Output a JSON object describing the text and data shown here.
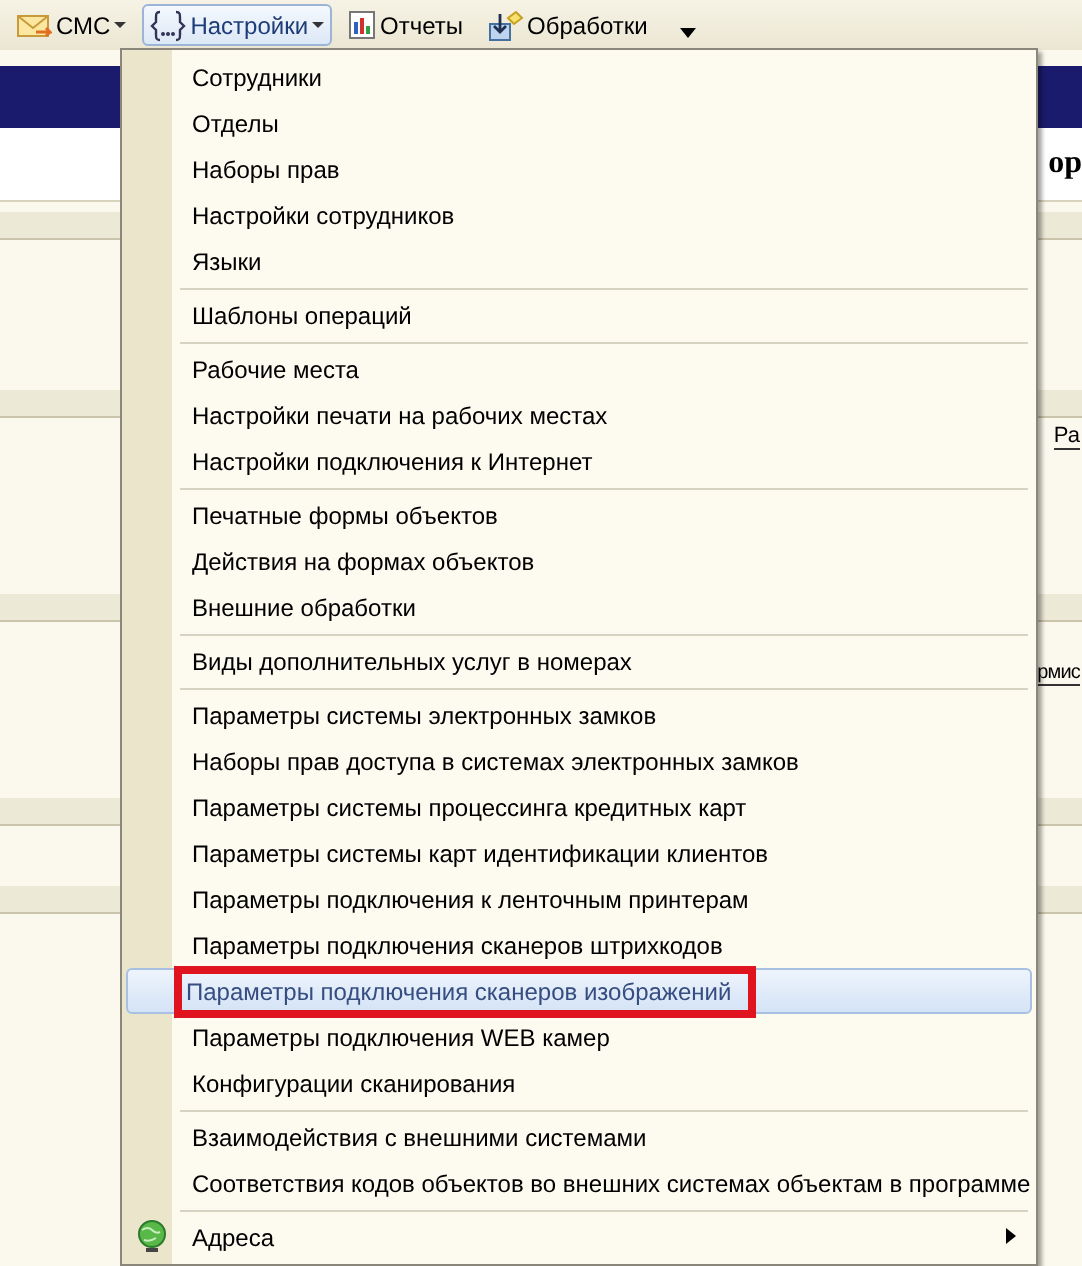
{
  "toolbar": [
    {
      "label": "СМС",
      "kind": "sms",
      "dropdown": true,
      "selected": false
    },
    {
      "label": "Настройки",
      "kind": "settings",
      "dropdown": true,
      "selected": true
    },
    {
      "label": "Отчеты",
      "kind": "reports",
      "dropdown": false,
      "selected": false
    },
    {
      "label": "Обработки",
      "kind": "tools",
      "dropdown": false,
      "selected": false
    }
  ],
  "background": {
    "header_fragment": "ор",
    "column_fragment": "Ра",
    "panel_fragment": "рмис"
  },
  "menu": {
    "groups": [
      [
        {
          "label": "Сотрудники",
          "kind": "command",
          "selected": false,
          "marked": false
        },
        {
          "label": "Отделы",
          "kind": "command",
          "selected": false,
          "marked": false
        },
        {
          "label": "Наборы прав",
          "kind": "command",
          "selected": false,
          "marked": false
        },
        {
          "label": "Настройки сотрудников",
          "kind": "command",
          "selected": false,
          "marked": false
        },
        {
          "label": "Языки",
          "kind": "command",
          "selected": false,
          "marked": false
        }
      ],
      [
        {
          "label": "Шаблоны операций",
          "kind": "command",
          "selected": false,
          "marked": false
        }
      ],
      [
        {
          "label": "Рабочие места",
          "kind": "command",
          "selected": false,
          "marked": false
        },
        {
          "label": "Настройки печати на рабочих местах",
          "kind": "command",
          "selected": false,
          "marked": false
        },
        {
          "label": "Настройки подключения к Интернет",
          "kind": "command",
          "selected": false,
          "marked": false
        }
      ],
      [
        {
          "label": "Печатные формы объектов",
          "kind": "command",
          "selected": false,
          "marked": false
        },
        {
          "label": "Действия на формах объектов",
          "kind": "command",
          "selected": false,
          "marked": false
        },
        {
          "label": "Внешние обработки",
          "kind": "command",
          "selected": false,
          "marked": false
        }
      ],
      [
        {
          "label": "Виды дополнительных услуг в номерах",
          "kind": "command",
          "selected": false,
          "marked": false
        }
      ],
      [
        {
          "label": "Параметры системы электронных замков",
          "kind": "command",
          "selected": false,
          "marked": false
        },
        {
          "label": "Наборы прав доступа в системах электронных замков",
          "kind": "command",
          "selected": false,
          "marked": false
        },
        {
          "label": "Параметры системы процессинга кредитных карт",
          "kind": "command",
          "selected": false,
          "marked": false
        },
        {
          "label": "Параметры системы карт идентификации клиентов",
          "kind": "command",
          "selected": false,
          "marked": false
        },
        {
          "label": "Параметры подключения к ленточным принтерам",
          "kind": "command",
          "selected": false,
          "marked": false
        },
        {
          "label": "Параметры подключения сканеров штрихкодов",
          "kind": "command",
          "selected": false,
          "marked": false
        },
        {
          "label": "Параметры подключения сканеров изображений",
          "kind": "command",
          "selected": true,
          "marked": true
        },
        {
          "label": "Параметры подключения WEB камер",
          "kind": "command",
          "selected": false,
          "marked": false
        },
        {
          "label": "Конфигурации сканирования",
          "kind": "command",
          "selected": false,
          "marked": false
        }
      ],
      [
        {
          "label": "Взаимодействия с внешними системами",
          "kind": "command",
          "selected": false,
          "marked": false
        },
        {
          "label": "Соответствия кодов объектов во внешних системах объектам в программе",
          "kind": "command",
          "selected": false,
          "marked": false
        }
      ],
      [
        {
          "label": "Адреса",
          "kind": "submenu",
          "selected": false,
          "marked": false
        }
      ]
    ]
  }
}
